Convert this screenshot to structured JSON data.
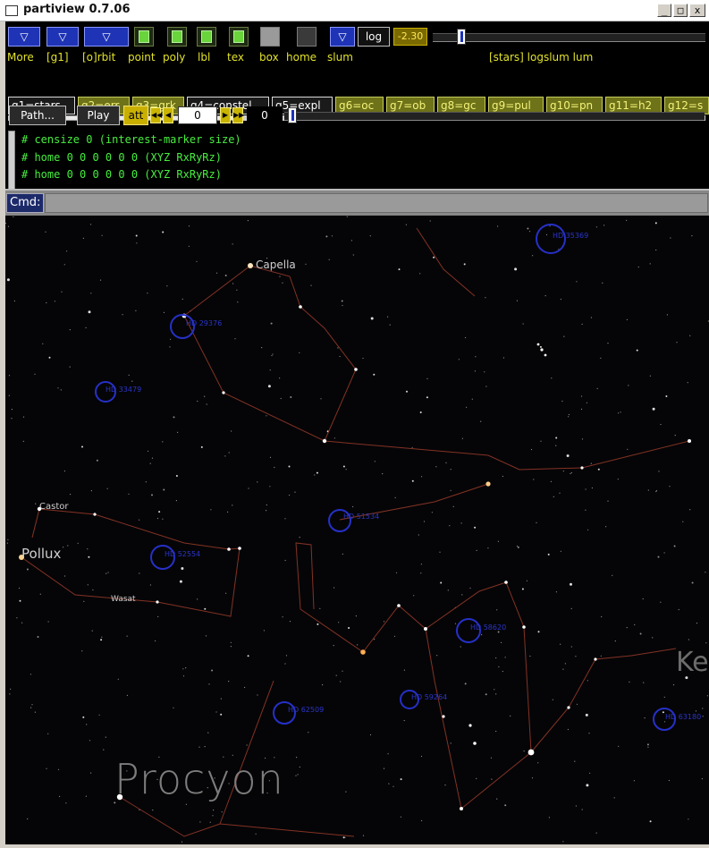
{
  "window": {
    "title": "partiview 0.7.06",
    "minimize_label": "_",
    "maximize_label": "□",
    "close_label": "x"
  },
  "toolbar_top": {
    "log_label": "log",
    "slum_value": "-2.30",
    "slum_slider_fraction": 0.04,
    "tri_glyph": "▽",
    "box_glyph": "◻"
  },
  "labels_row": {
    "more": "More",
    "group": "[g1]",
    "orbit": "[o]rbit",
    "point": "point",
    "poly": "poly",
    "lbl": "lbl",
    "tex": "tex",
    "box": "box",
    "home": "home",
    "slum": "slum",
    "data_label": "[stars] logslum lum"
  },
  "groups": [
    {
      "label": "g1=stars",
      "active": true
    },
    {
      "label": "g2=err",
      "active": false
    },
    {
      "label": "g3=grk",
      "active": false
    },
    {
      "label": "g4=constel",
      "active": true
    },
    {
      "label": "g5=expl",
      "active": true
    },
    {
      "label": "g6=oc",
      "active": false
    },
    {
      "label": "g7=ob",
      "active": false
    },
    {
      "label": "g8=gc",
      "active": false
    },
    {
      "label": "g9=pul",
      "active": false
    },
    {
      "label": "g10=pn",
      "active": false
    },
    {
      "label": "g11=h2",
      "active": false
    },
    {
      "label": "g12=s",
      "active": false
    }
  ],
  "playback": {
    "path_label": "Path...",
    "play_label": "Play",
    "att_label": "att",
    "frame_value": "0",
    "speed_value": "0",
    "arrow_first": "◀◀",
    "arrow_prev": "◀",
    "arrow_next": "▶",
    "arrow_last": "▶▶"
  },
  "log_lines": [
    "# censize 0  (interest-marker size)",
    "# home 0 0 0  0 0 0  (XYZ RxRyRz)",
    "# home 0 0 0  0 0 0  (XYZ RxRyRz)"
  ],
  "command": {
    "label": "Cmd:",
    "value": ""
  },
  "sky": {
    "star_labels": {
      "capella": "Capella",
      "castor": "Castor",
      "pollux": "Pollux",
      "wasat": "Wasat"
    },
    "big_labels": {
      "procyon": "Procyon",
      "edge": "Ke"
    },
    "marker_labels": {
      "m1": "HD 35369",
      "m2": "HD 29376",
      "m3": "HD 33479",
      "m4": "HD 51534",
      "m5": "HD 52554",
      "m6": "HD 58620",
      "m7": "HD 59264",
      "m8": "HD 62509",
      "m9": "HD 63180"
    }
  }
}
